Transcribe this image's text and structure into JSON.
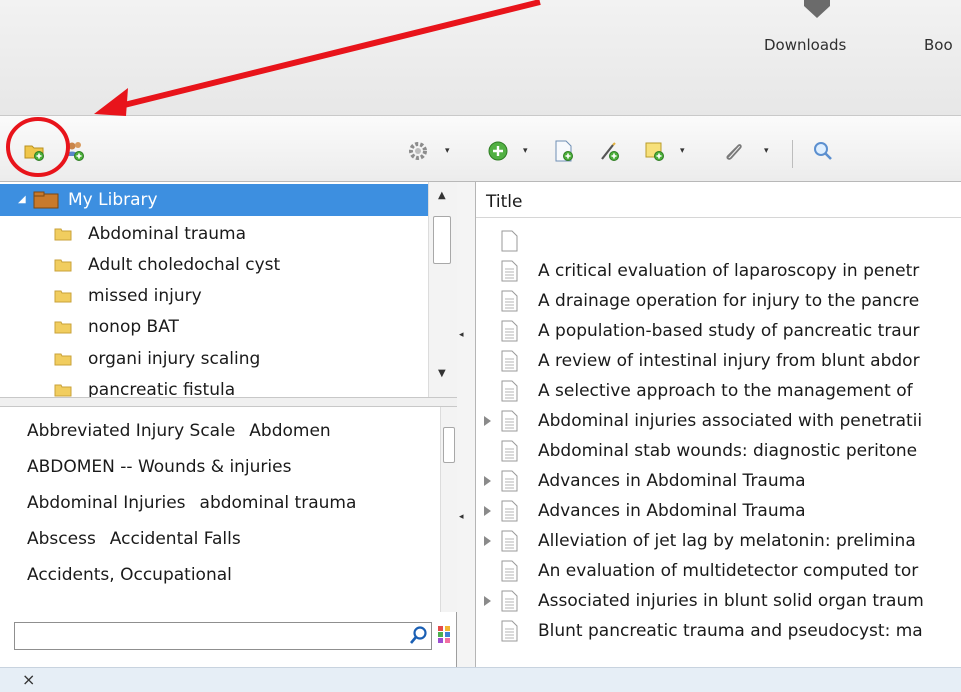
{
  "browser_bar": {
    "downloads_label": "Downloads",
    "bookmarks_label": "Boo"
  },
  "toolbar": {
    "new_collection_icon": "folder-add-icon",
    "new_group_icon": "group-add-icon",
    "actions_icon": "gear-icon",
    "new_item_icon": "green-plus-icon",
    "add_by_identifier_icon": "document-add-icon",
    "new_note_icon": "note-wand-icon",
    "new_standalone_note_icon": "note-add-icon",
    "attach_icon": "paperclip-icon",
    "search_icon": "magnifier-icon",
    "dropdown_glyph": "▾"
  },
  "library_tree": {
    "root_label": "My Library",
    "collections": [
      "Abdominal trauma",
      "Adult choledochal cyst",
      "missed injury",
      "nonop BAT",
      "organi injury scaling",
      "pancreatic fistula"
    ]
  },
  "tag_selector": {
    "lines": [
      [
        "Abbreviated Injury Scale",
        "Abdomen"
      ],
      [
        "ABDOMEN -- Wounds & injuries"
      ],
      [
        "Abdominal Injuries",
        "abdominal trauma"
      ],
      [
        "Abscess",
        "Accidental Falls"
      ],
      [
        "Accidents, Occupational"
      ]
    ],
    "filter_value": "",
    "search_icon": "magnifier-icon",
    "tag_menu_icon": "color-grid-icon"
  },
  "items_pane": {
    "column_title": "Title",
    "items": [
      {
        "title": "",
        "expandable": false
      },
      {
        "title": "A critical evaluation of laparoscopy in penetr",
        "expandable": false
      },
      {
        "title": "A drainage operation for injury to the pancre",
        "expandable": false
      },
      {
        "title": "A population-based study of pancreatic traur",
        "expandable": false
      },
      {
        "title": "A review of intestinal injury from blunt abdor",
        "expandable": false
      },
      {
        "title": "A selective approach to the management of",
        "expandable": false
      },
      {
        "title": "Abdominal injuries associated with penetratii",
        "expandable": true
      },
      {
        "title": "Abdominal stab wounds: diagnostic peritone",
        "expandable": false
      },
      {
        "title": "Advances in Abdominal Trauma",
        "expandable": true
      },
      {
        "title": "Advances in Abdominal Trauma",
        "expandable": true
      },
      {
        "title": "Alleviation of jet lag by melatonin: prelimina",
        "expandable": true
      },
      {
        "title": "An evaluation of multidetector computed tor",
        "expandable": false
      },
      {
        "title": "Associated injuries in blunt solid organ traum",
        "expandable": true
      },
      {
        "title": "Blunt pancreatic trauma and pseudocyst: ma",
        "expandable": false
      }
    ]
  },
  "status_bar": {
    "close_glyph": "×"
  },
  "annotation": {
    "color": "#e8141b"
  }
}
